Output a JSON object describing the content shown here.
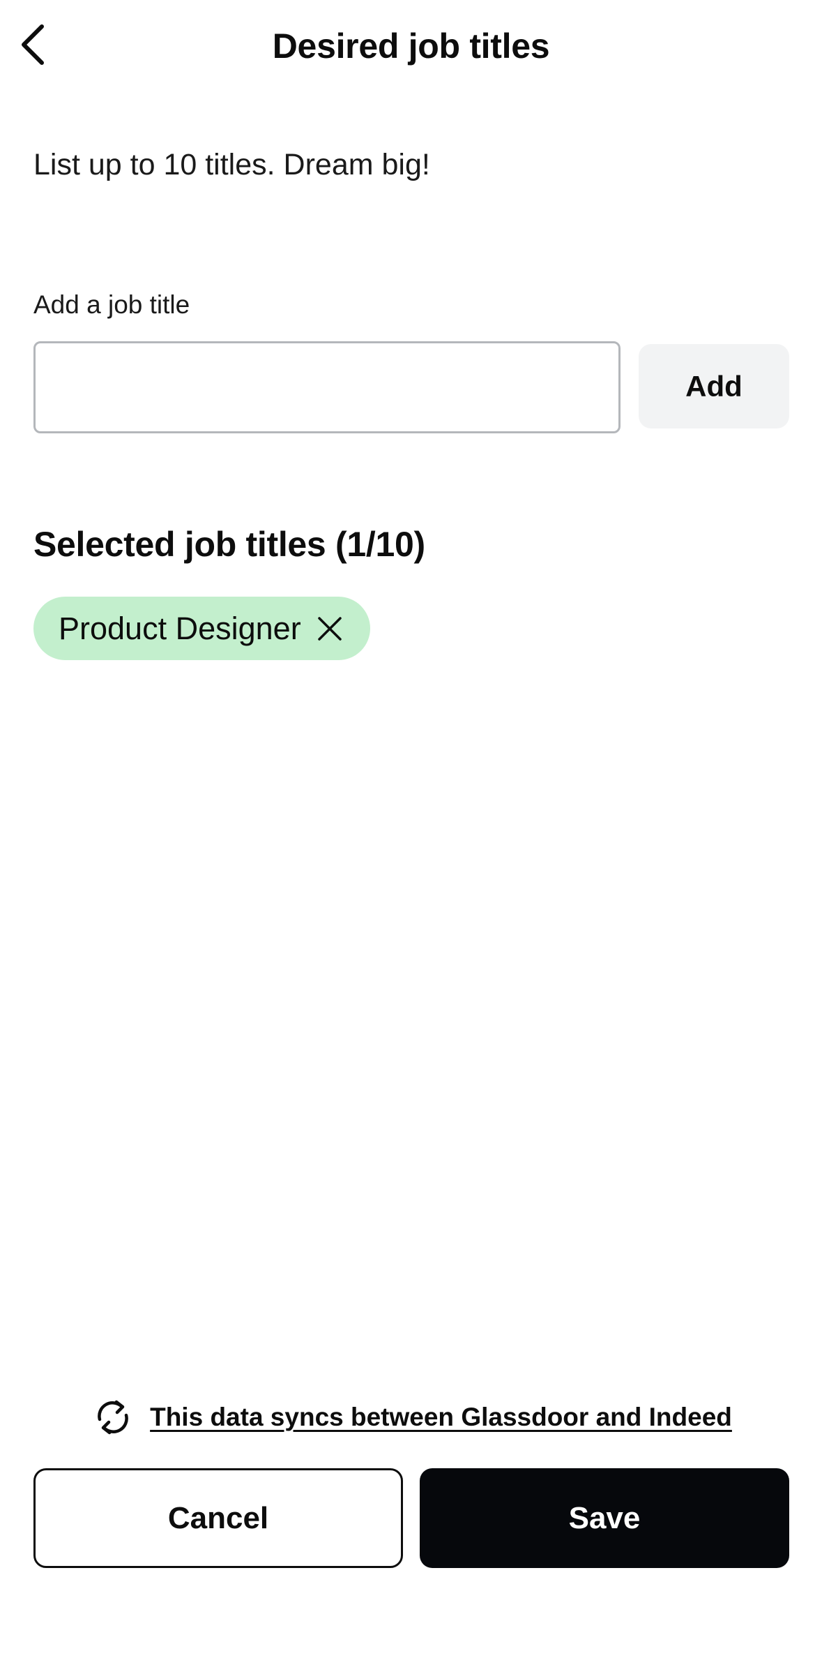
{
  "header": {
    "title": "Desired job titles",
    "back_icon": "chevron-left-icon"
  },
  "intro": {
    "text": "List up to 10 titles. Dream big!"
  },
  "add_title": {
    "label": "Add a job title",
    "value": "",
    "placeholder": "",
    "button_label": "Add"
  },
  "selected": {
    "heading": "Selected job titles (1/10)",
    "chips": [
      {
        "label": "Product Designer",
        "remove_icon": "close-icon"
      }
    ],
    "chip_color": "#c3efcd"
  },
  "sync": {
    "icon": "sync-icon",
    "text": "This data syncs between Glassdoor and Indeed"
  },
  "actions": {
    "cancel_label": "Cancel",
    "save_label": "Save"
  },
  "colors": {
    "primary_button": "#06080c",
    "add_button_bg": "#f2f3f4",
    "input_border": "#b4b7bb"
  }
}
